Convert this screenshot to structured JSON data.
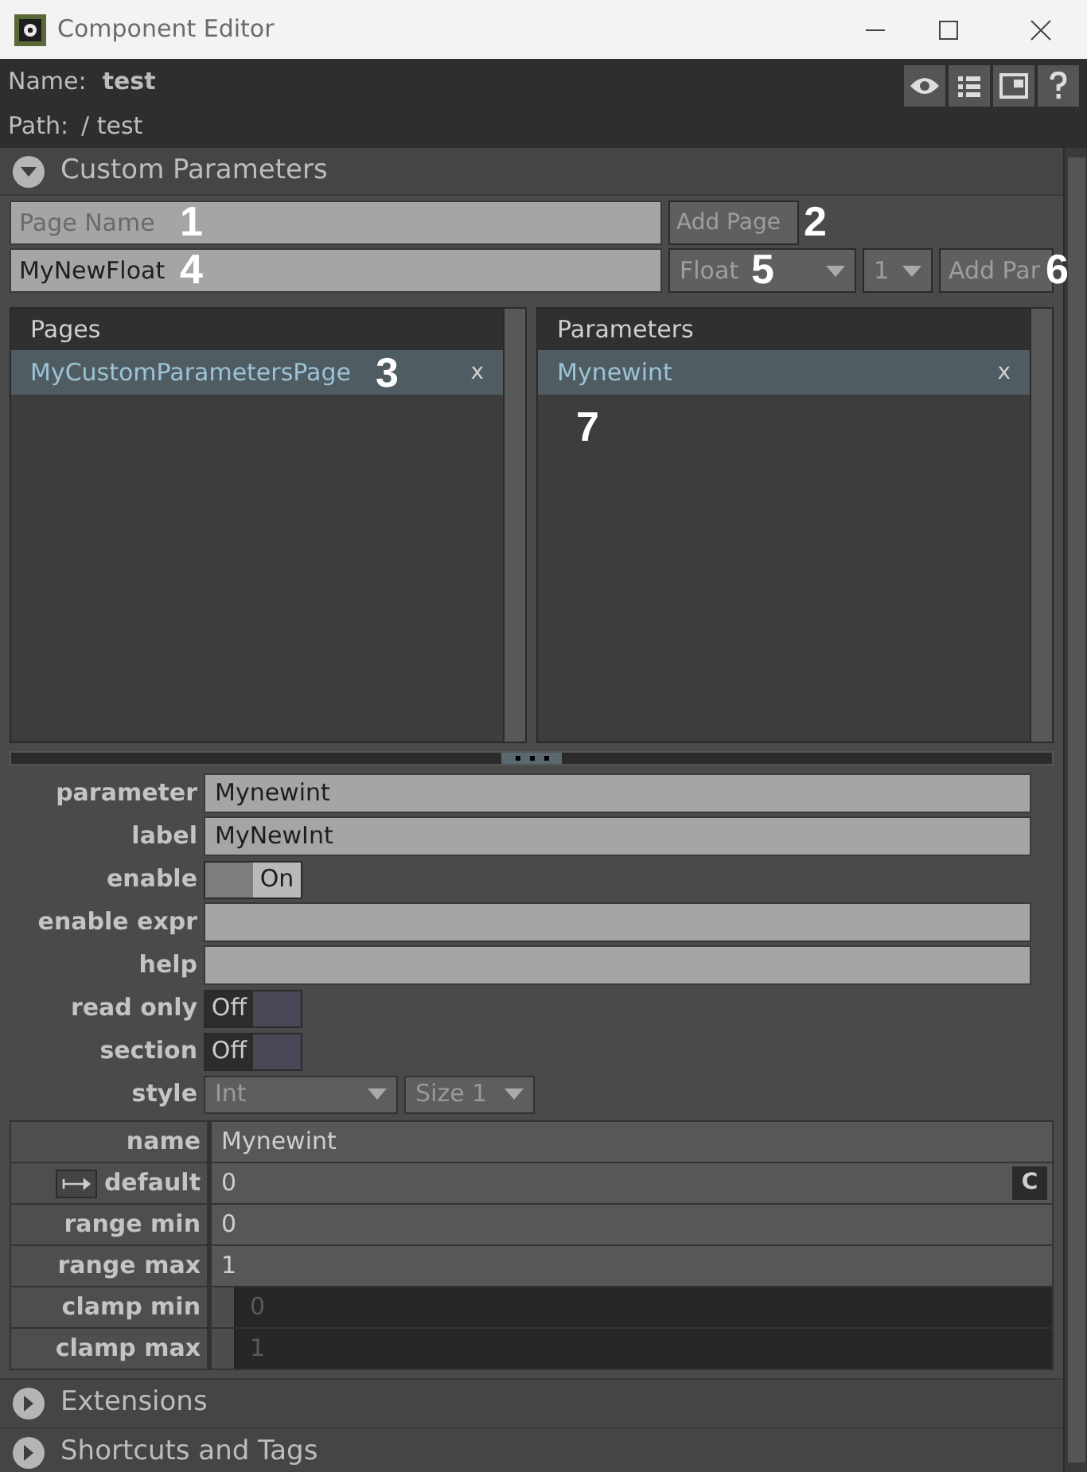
{
  "window": {
    "title": "Component Editor"
  },
  "header": {
    "name_label": "Name:",
    "name": "test",
    "path_label": "Path:",
    "path": "/ test"
  },
  "section": {
    "title": "Custom Parameters",
    "expanded": true
  },
  "page_name": {
    "placeholder": "Page Name"
  },
  "add_page": "Add Page",
  "param_name": {
    "value": "MyNewFloat"
  },
  "type_dropdown": "Float",
  "size_dropdown": "1",
  "add_par": "Add Par",
  "pages": {
    "title": "Pages",
    "items": [
      {
        "label": "MyCustomParametersPage",
        "selected": true,
        "remove": "x"
      }
    ]
  },
  "parameters": {
    "title": "Parameters",
    "items": [
      {
        "label": "Mynewint",
        "selected": true,
        "remove": "x"
      }
    ]
  },
  "fields": [
    {
      "kind": "text",
      "label": "parameter",
      "value": "Mynewint"
    },
    {
      "kind": "text",
      "label": "label",
      "value": "MyNewInt"
    },
    {
      "kind": "toggle",
      "label": "enable",
      "on": true,
      "state_text": "On"
    },
    {
      "kind": "text",
      "label": "enable expr"
    },
    {
      "kind": "text",
      "label": "help"
    },
    {
      "kind": "toggle",
      "label": "read only",
      "on": false,
      "state_text": "Off"
    },
    {
      "kind": "toggle",
      "label": "section",
      "on": false,
      "state_text": "Off"
    },
    {
      "kind": "dropdowns",
      "label": "style",
      "options": [
        "Int",
        "Size 1"
      ]
    }
  ],
  "table": [
    {
      "kind": "plain",
      "label": "name",
      "value": "Mynewint"
    },
    {
      "kind": "default",
      "label": "default",
      "value": "0",
      "button": "C"
    },
    {
      "kind": "plain",
      "label": "range min",
      "value": "0"
    },
    {
      "kind": "plain",
      "label": "range max",
      "value": "1"
    },
    {
      "kind": "clamp",
      "label": "clamp min",
      "value": "0",
      "checked": false
    },
    {
      "kind": "clamp",
      "label": "clamp max",
      "value": "1",
      "checked": false
    }
  ],
  "collapsed_sections": [
    {
      "title": "Extensions",
      "expanded": false
    },
    {
      "title": "Shortcuts and Tags",
      "expanded": false
    }
  ],
  "callouts": [
    "1",
    "2",
    "3",
    "4",
    "5",
    "6",
    "7"
  ]
}
